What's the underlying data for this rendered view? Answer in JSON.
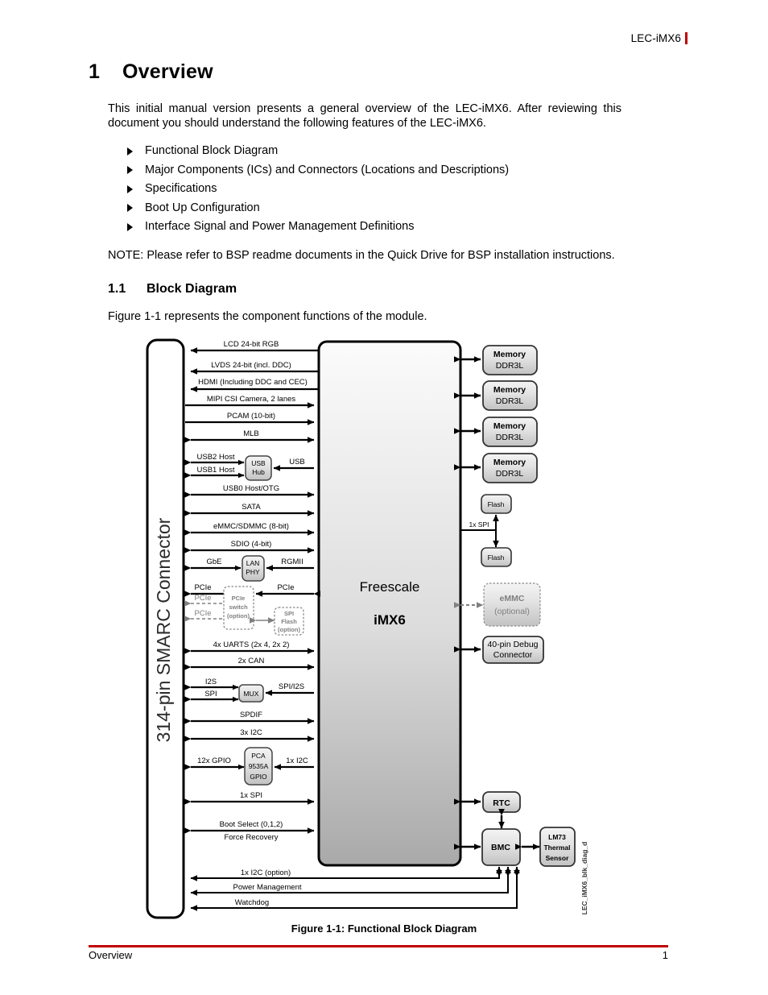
{
  "header": {
    "title": "LEC-iMX6",
    "accent_color": "#c00000"
  },
  "chapter": {
    "number": "1",
    "title": "Overview"
  },
  "intro": "This initial manual version presents a general overview of the LEC-iMX6. After reviewing this document you should understand the following features of the LEC-iMX6.",
  "bullets": [
    "Functional Block Diagram",
    "Major Components (ICs) and Connectors (Locations and Descriptions)",
    "Specifications",
    "Boot Up Configuration",
    "Interface Signal and Power Management Definitions"
  ],
  "note": "NOTE: Please refer to BSP readme documents in the Quick Drive for BSP installation instructions.",
  "section": {
    "number": "1.1",
    "title": "Block Diagram"
  },
  "section_intro": "Figure 1-1 represents the component functions of the module.",
  "figure": {
    "caption": "Figure 1-1: Functional Block Diagram",
    "watermark_code": "LEC_iMX6_blk_diag_d"
  },
  "footer": {
    "left": "Overview",
    "page": "1"
  },
  "diagram": {
    "connector_label": "314-pin SMARC Connector",
    "soc": {
      "vendor": "Freescale",
      "part": "iMX6"
    },
    "left_signals": [
      {
        "label": "LCD 24-bit RGB",
        "dir": "left"
      },
      {
        "label": "LVDS 24-bit (incl. DDC)",
        "dir": "left"
      },
      {
        "label": "HDMI (Including DDC and CEC)",
        "dir": "left"
      },
      {
        "label": "MIPI CSI Camera, 2 lanes",
        "dir": "right"
      },
      {
        "label": "PCAM (10-bit)",
        "dir": "right"
      },
      {
        "label": "MLB",
        "dir": "both"
      },
      {
        "label": "USB0 Host/OTG",
        "dir": "both"
      },
      {
        "label": "SATA",
        "dir": "both"
      },
      {
        "label": "eMMC/SDMMC (8-bit)",
        "dir": "both"
      },
      {
        "label": "SDIO (4-bit)",
        "dir": "both"
      },
      {
        "label": "4x UARTS (2x 4, 2x 2)",
        "dir": "both"
      },
      {
        "label": "2x CAN",
        "dir": "both"
      },
      {
        "label": "SPDIF",
        "dir": "both"
      },
      {
        "label": "3x I2C",
        "dir": "both"
      },
      {
        "label": "1x SPI",
        "dir": "both"
      }
    ],
    "usb_group": {
      "in_top": "USB2 Host",
      "in_bottom": "USB1 Host",
      "block": "USB Hub",
      "block_line1": "USB",
      "block_line2": "Hub",
      "out": "USB"
    },
    "lan_group": {
      "in": "GbE",
      "block_line1": "LAN",
      "block_line2": "PHY",
      "out": "RGMII"
    },
    "pcie_group": {
      "primary_in": "PCIe",
      "primary_out": "PCIe",
      "optional_in_1": "PCIe",
      "optional_in_2": "PCIe",
      "switch_line1": "PCIe",
      "switch_line2": "switch",
      "switch_line3": "(option)",
      "spi_flash_line1": "SPI",
      "spi_flash_line2": "Flash",
      "spi_flash_line3": "(option)"
    },
    "mux_group": {
      "in_top": "I2S",
      "in_bottom": "SPI",
      "block": "MUX",
      "out": "SPI/I2S"
    },
    "gpio_group": {
      "in": "12x GPIO",
      "block_line1": "PCA",
      "block_line2": "9535A",
      "block_line3": "GPIO",
      "out": "1x I2C"
    },
    "boot_signals": [
      "Boot Select (0,1,2)",
      "Force Recovery"
    ],
    "bmc_signals": [
      "1x I2C (option)",
      "Power Management",
      "Watchdog"
    ],
    "right_blocks": [
      {
        "line1": "Memory",
        "line2": "DDR3L"
      },
      {
        "line1": "Memory",
        "line2": "DDR3L"
      },
      {
        "line1": "Memory",
        "line2": "DDR3L"
      },
      {
        "line1": "Memory",
        "line2": "DDR3L"
      }
    ],
    "flash_group": {
      "bus": "1x SPI",
      "top": "Flash",
      "bottom": "Flash"
    },
    "emmc_block": {
      "line1": "eMMC",
      "line2": "(optional)"
    },
    "debug_block": {
      "line1": "40-pin Debug",
      "line2": "Connector"
    },
    "rtc_block": {
      "label": "RTC"
    },
    "bmc_block": {
      "label": "BMC"
    },
    "thermal_block": {
      "line1": "LM73",
      "line2": "Thermal",
      "line3": "Sensor"
    }
  }
}
